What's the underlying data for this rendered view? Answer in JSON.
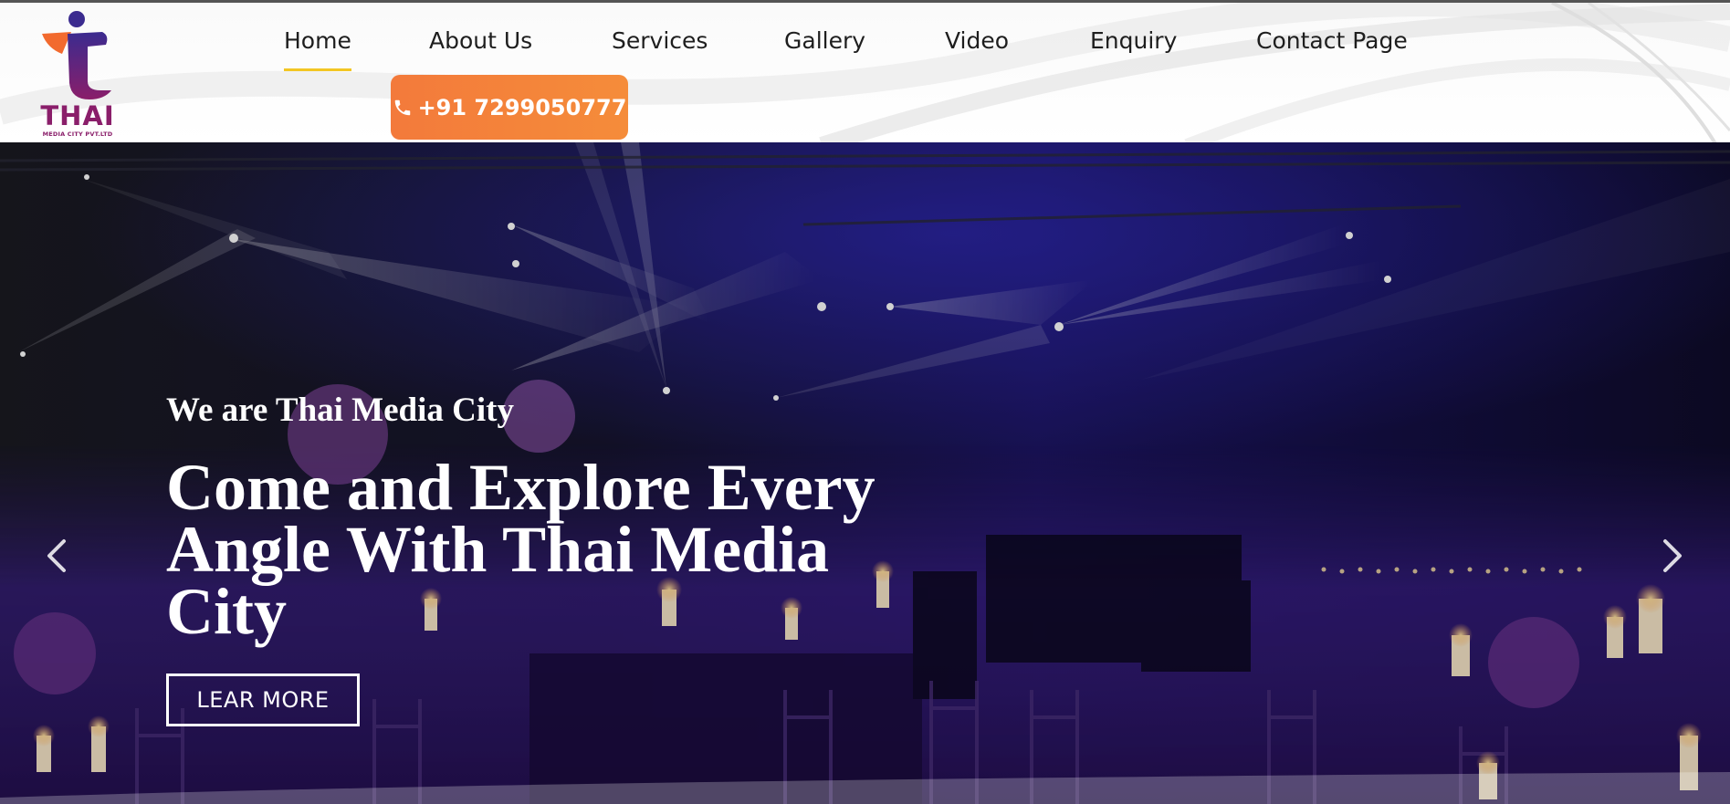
{
  "brand": {
    "name": "THAI",
    "tagline": "MEDIA CITY PVT.LTD",
    "colors": {
      "logo_purple": "#8a1e6a",
      "logo_orange": "#f26a2e",
      "logo_blue": "#3b2b8f"
    }
  },
  "nav": {
    "items": [
      {
        "label": "Home",
        "active": true
      },
      {
        "label": "About Us",
        "active": false
      },
      {
        "label": "Services",
        "active": false
      },
      {
        "label": "Gallery",
        "active": false
      },
      {
        "label": "Video",
        "active": false
      },
      {
        "label": "Enquiry",
        "active": false
      },
      {
        "label": "Contact Page",
        "active": false
      }
    ],
    "active_underline_color": "#f3c623"
  },
  "phone": {
    "label": "+91 7299050777",
    "icon": "phone-icon",
    "color": "#f37a3b"
  },
  "hero": {
    "subtitle": "We are Thai Media City",
    "title": "Come and Explore Every Angle With Thai Media City",
    "cta_label": "LEAR MORE",
    "prev_icon": "chevron-left-icon",
    "next_icon": "chevron-right-icon"
  }
}
